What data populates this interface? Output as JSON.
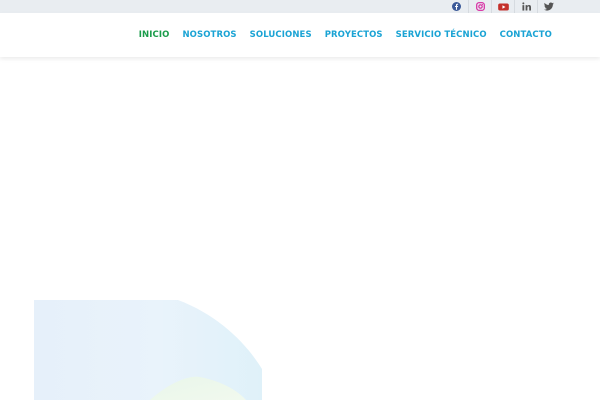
{
  "colors": {
    "topbar_bg": "#e9edf1",
    "nav_text": "#1aa3d4",
    "nav_active": "#1a9c4a",
    "facebook": "#3b5998",
    "instagram": "#d6249f",
    "youtube": "#c4302b",
    "linkedin": "#555555",
    "twitter": "#555555"
  },
  "social": [
    {
      "icon": "facebook-icon"
    },
    {
      "icon": "instagram-icon"
    },
    {
      "icon": "youtube-icon"
    },
    {
      "icon": "linkedin-icon"
    },
    {
      "icon": "twitter-icon"
    }
  ],
  "nav": {
    "items": [
      {
        "label": "INICIO",
        "active": true
      },
      {
        "label": "NOSOTROS"
      },
      {
        "label": "SOLUCIONES"
      },
      {
        "label": "PROYECTOS"
      },
      {
        "label": "SERVICIO TÉCNICO"
      },
      {
        "label": "CONTACTO"
      }
    ]
  }
}
